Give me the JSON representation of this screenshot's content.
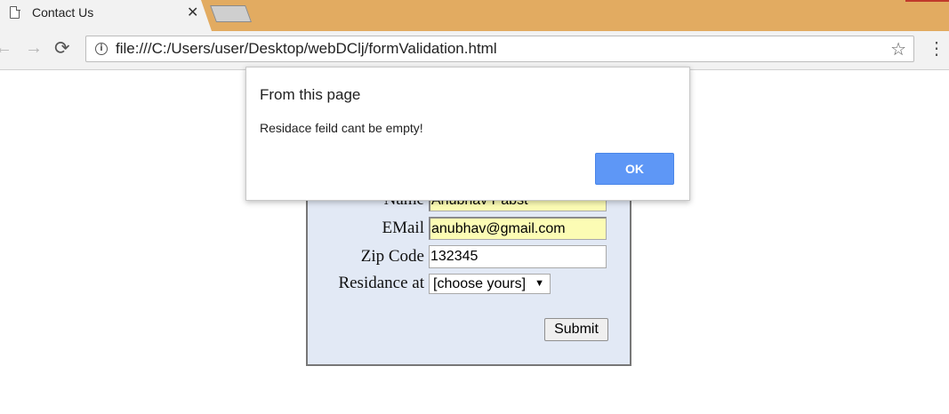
{
  "browser": {
    "tab": {
      "title": "Contact Us",
      "close_glyph": "✕",
      "icon": "document-icon"
    },
    "nav": {
      "back_glyph": "←",
      "forward_glyph": "→",
      "reload_glyph": "⟳"
    },
    "address_bar": {
      "info_glyph": "i",
      "url": "file:///C:/Users/user/Desktop/webDClj/formValidation.html",
      "star_glyph": "☆"
    },
    "menu_glyph": "⋮",
    "accent_color": "#e2ab61"
  },
  "form": {
    "name_label": "Name",
    "name_value": "Anubhav Pabst",
    "email_label": "EMail",
    "email_value": "anubhav@gmail.com",
    "zip_label": "Zip Code",
    "zip_value": "132345",
    "residence_label": "Residance at",
    "residence_selected": "[choose yours]",
    "select_arrow": "▼",
    "submit_label": "Submit",
    "background_color": "#e2e9f5"
  },
  "dialog": {
    "title": "From this page",
    "message": "Residace feild cant be empty!",
    "ok_label": "OK",
    "button_color": "#5e97f6"
  }
}
